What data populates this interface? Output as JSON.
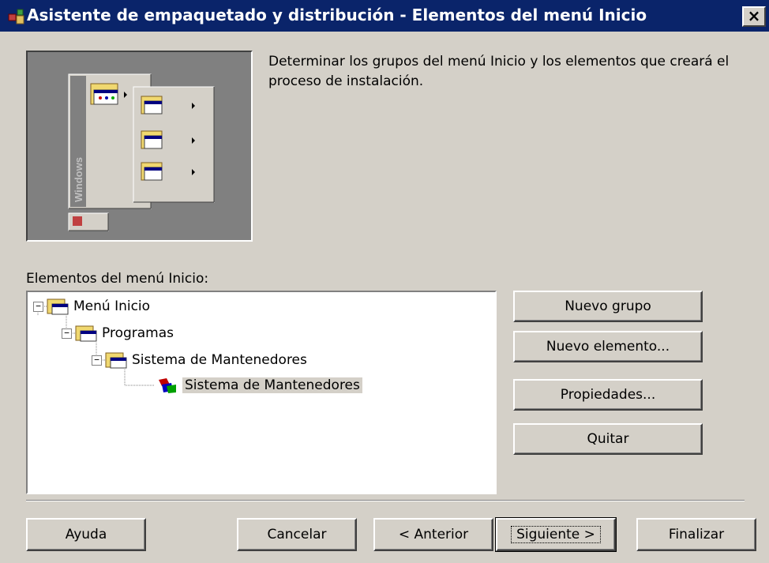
{
  "window": {
    "title": "Asistente de empaquetado y distribución - Elementos del menú Inicio",
    "close_label": "×"
  },
  "description": "Determinar los grupos del menú Inicio y los elementos que creará el proceso de instalación.",
  "illustration": {
    "sidebar_text": "Windows"
  },
  "tree": {
    "label": "Elementos del menú Inicio:",
    "items": [
      {
        "label": "Menú Inicio",
        "expanded": true
      },
      {
        "label": "Programas",
        "expanded": true
      },
      {
        "label": "Sistema de Mantenedores",
        "expanded": true
      },
      {
        "label": "Sistema de Mantenedores",
        "selected": true
      }
    ]
  },
  "side_buttons": {
    "new_group": "Nuevo grupo",
    "new_item": "Nuevo elemento...",
    "properties": "Propiedades...",
    "remove": "Quitar"
  },
  "footer_buttons": {
    "help": "Ayuda",
    "cancel": "Cancelar",
    "back": "< Anterior",
    "next": "Siguiente >",
    "finish": "Finalizar"
  },
  "colors": {
    "titlebar": "#0a246a",
    "face": "#d4d0c8"
  }
}
